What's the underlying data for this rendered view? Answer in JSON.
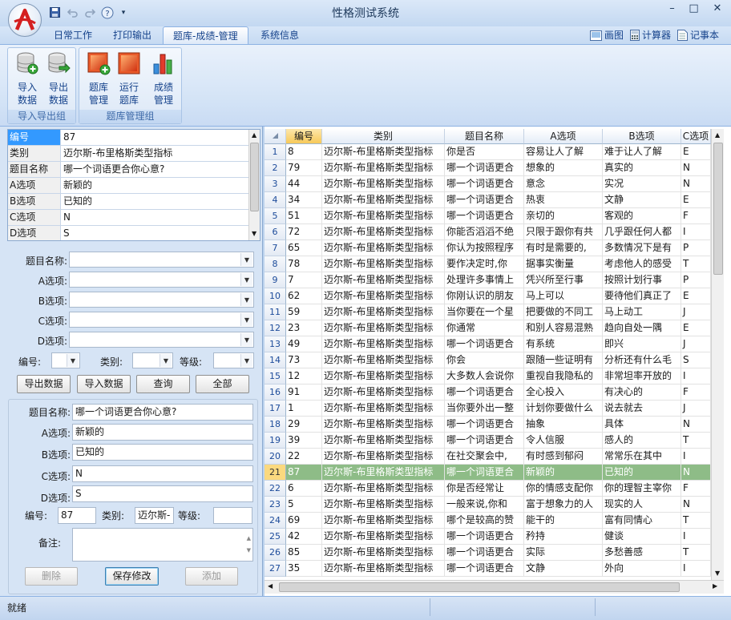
{
  "window": {
    "title": "性格测试系统",
    "minimize": "–",
    "maximize": "□",
    "close": "✕"
  },
  "menu": {
    "tabs": [
      "日常工作",
      "打印输出",
      "题库-成绩-管理",
      "系统信息"
    ],
    "active": 2,
    "tools": [
      {
        "label": "画图",
        "icon": "paint-icon"
      },
      {
        "label": "计算器",
        "icon": "calculator-icon"
      },
      {
        "label": "记事本",
        "icon": "notepad-icon"
      }
    ]
  },
  "ribbon": {
    "group1": {
      "caption": "导入导出组",
      "buttons": [
        {
          "line1": "导入",
          "line2": "数据"
        },
        {
          "line1": "导出",
          "line2": "数据"
        }
      ]
    },
    "group2": {
      "caption": "题库管理组",
      "buttons": [
        {
          "line1": "题库",
          "line2": "管理"
        },
        {
          "line1": "运行",
          "line2": "题库"
        },
        {
          "line1": "成绩",
          "line2": "管理"
        }
      ]
    }
  },
  "detail": [
    {
      "k": "编号",
      "v": "87"
    },
    {
      "k": "类别",
      "v": "迈尔斯-布里格斯类型指标"
    },
    {
      "k": "题目名称",
      "v": "哪一个词语更合你心意?"
    },
    {
      "k": "A选项",
      "v": "新颖的"
    },
    {
      "k": "B选项",
      "v": "已知的"
    },
    {
      "k": "C选项",
      "v": "N"
    },
    {
      "k": "D选项",
      "v": "S"
    }
  ],
  "search": {
    "name": "题目名称:",
    "a": "A选项:",
    "b": "B选项:",
    "c": "C选项:",
    "d": "D选项:",
    "no": "编号:",
    "cat": "类别:",
    "level": "等级:",
    "buttons": [
      "导出数据",
      "导入数据",
      "查询",
      "全部"
    ]
  },
  "edit": {
    "name_label": "题目名称:",
    "name": "哪一个词语更合你心意?",
    "a_label": "A选项:",
    "a": "新颖的",
    "b_label": "B选项:",
    "b": "已知的",
    "c_label": "C选项:",
    "c": "N",
    "d_label": "D选项:",
    "d": "S",
    "no_label": "编号:",
    "no": "87",
    "cat_label": "类别:",
    "cat": "迈尔斯-",
    "level_label": "等级:",
    "level": "",
    "note_label": "备注:",
    "note": "",
    "delete": "删除",
    "save": "保存修改",
    "add": "添加"
  },
  "grid": {
    "headers": [
      "编号",
      "类别",
      "题目名称",
      "A选项",
      "B选项",
      "C选项"
    ],
    "selected_row": 21,
    "rows": [
      [
        "8",
        "迈尔斯-布里格斯类型指标",
        "你是否",
        "容易让人了解",
        "难于让人了解",
        "E"
      ],
      [
        "79",
        "迈尔斯-布里格斯类型指标",
        "哪一个词语更合",
        "想象的",
        "真实的",
        "N"
      ],
      [
        "44",
        "迈尔斯-布里格斯类型指标",
        "哪一个词语更合",
        "意念",
        "实况",
        "N"
      ],
      [
        "34",
        "迈尔斯-布里格斯类型指标",
        "哪一个词语更合",
        "热衷",
        "文静",
        "E"
      ],
      [
        "51",
        "迈尔斯-布里格斯类型指标",
        "哪一个词语更合",
        "亲切的",
        "客观的",
        "F"
      ],
      [
        "72",
        "迈尔斯-布里格斯类型指标",
        "你能否滔滔不绝",
        "只限于跟你有共",
        "几乎跟任何人都",
        "I"
      ],
      [
        "65",
        "迈尔斯-布里格斯类型指标",
        "你认为按照程序",
        "有时是需要的,",
        "多数情况下是有",
        "P"
      ],
      [
        "78",
        "迈尔斯-布里格斯类型指标",
        "要作决定时,你",
        "据事实衡量",
        "考虑他人的感受",
        "T"
      ],
      [
        "7",
        "迈尔斯-布里格斯类型指标",
        "处理许多事情上",
        "凭兴所至行事",
        "按照计划行事",
        "P"
      ],
      [
        "62",
        "迈尔斯-布里格斯类型指标",
        "你刚认识的朋友",
        "马上可以",
        "要待他们真正了",
        "E"
      ],
      [
        "59",
        "迈尔斯-布里格斯类型指标",
        "当你要在一个星",
        "把要做的不同工",
        "马上动工",
        "J"
      ],
      [
        "23",
        "迈尔斯-布里格斯类型指标",
        "你通常",
        "和别人容易混熟",
        "趋向自处一隅",
        "E"
      ],
      [
        "49",
        "迈尔斯-布里格斯类型指标",
        "哪一个词语更合",
        "有系统",
        "即兴",
        "J"
      ],
      [
        "73",
        "迈尔斯-布里格斯类型指标",
        "你会",
        "跟随一些证明有",
        "分析还有什么毛",
        "S"
      ],
      [
        "12",
        "迈尔斯-布里格斯类型指标",
        "大多数人会说你",
        "重视自我隐私的",
        "非常坦率开放的",
        "I"
      ],
      [
        "91",
        "迈尔斯-布里格斯类型指标",
        "哪一个词语更合",
        "全心投入",
        "有决心的",
        "F"
      ],
      [
        "1",
        "迈尔斯-布里格斯类型指标",
        "当你要外出一整",
        "计划你要做什么",
        "说去就去",
        "J"
      ],
      [
        "29",
        "迈尔斯-布里格斯类型指标",
        "哪一个词语更合",
        "抽象",
        "具体",
        "N"
      ],
      [
        "39",
        "迈尔斯-布里格斯类型指标",
        "哪一个词语更合",
        "令人信服",
        "感人的",
        "T"
      ],
      [
        "22",
        "迈尔斯-布里格斯类型指标",
        "在社交聚会中,",
        "有时感到郁闷",
        "常常乐在其中",
        "I"
      ],
      [
        "87",
        "迈尔斯-布里格斯类型指标",
        "哪一个词语更合",
        "新颖的",
        "已知的",
        "N"
      ],
      [
        "6",
        "迈尔斯-布里格斯类型指标",
        "你是否经常让",
        "你的情感支配你",
        "你的理智主宰你",
        "F"
      ],
      [
        "5",
        "迈尔斯-布里格斯类型指标",
        "一般来说,你和",
        "富于想象力的人",
        "现实的人",
        "N"
      ],
      [
        "69",
        "迈尔斯-布里格斯类型指标",
        "哪个是较高的赞",
        "能干的",
        "富有同情心",
        "T"
      ],
      [
        "42",
        "迈尔斯-布里格斯类型指标",
        "哪一个词语更合",
        "矜持",
        "健谈",
        "I"
      ],
      [
        "85",
        "迈尔斯-布里格斯类型指标",
        "哪一个词语更合",
        "实际",
        "多愁善感",
        "T"
      ],
      [
        "35",
        "迈尔斯-布里格斯类型指标",
        "哪一个词语更合",
        "文静",
        "外向",
        "I"
      ]
    ]
  },
  "status": {
    "text": "就绪"
  }
}
